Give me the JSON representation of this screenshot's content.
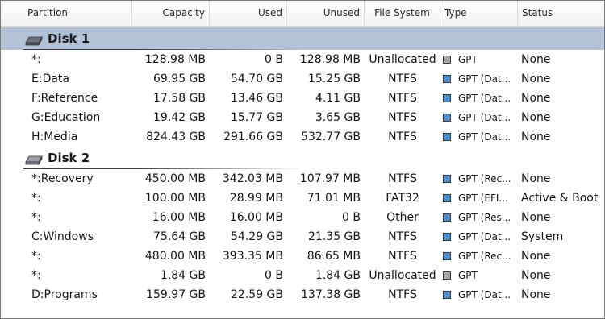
{
  "columns": {
    "partition": "Partition",
    "capacity": "Capacity",
    "used": "Used",
    "unused": "Unused",
    "filesystem": "File System",
    "type": "Type",
    "status": "Status"
  },
  "colors": {
    "selected_row": "#b3c2d6",
    "gpt_data_square": "#4a8ecb",
    "unallocated_square": "#a8a8a8"
  },
  "disks": [
    {
      "label": "Disk 1",
      "icon": "hard-disk-icon",
      "selected": true,
      "partitions": [
        {
          "name": "*:",
          "capacity": "128.98 MB",
          "used": "0 B",
          "unused": "128.98 MB",
          "fs": "Unallocated",
          "type": "GPT",
          "status": "None",
          "kind": "unallocated"
        },
        {
          "name": "E:Data",
          "capacity": "69.95 GB",
          "used": "54.70 GB",
          "unused": "15.25 GB",
          "fs": "NTFS",
          "type": "GPT (Dat...",
          "status": "None",
          "kind": "data"
        },
        {
          "name": "F:Reference",
          "capacity": "17.58 GB",
          "used": "13.46 GB",
          "unused": "4.11 GB",
          "fs": "NTFS",
          "type": "GPT (Dat...",
          "status": "None",
          "kind": "data"
        },
        {
          "name": "G:Education",
          "capacity": "19.42 GB",
          "used": "15.77 GB",
          "unused": "3.65 GB",
          "fs": "NTFS",
          "type": "GPT (Dat...",
          "status": "None",
          "kind": "data"
        },
        {
          "name": "H:Media",
          "capacity": "824.43 GB",
          "used": "291.66 GB",
          "unused": "532.77 GB",
          "fs": "NTFS",
          "type": "GPT (Dat...",
          "status": "None",
          "kind": "data"
        }
      ]
    },
    {
      "label": "Disk 2",
      "icon": "hard-disk-icon",
      "selected": false,
      "partitions": [
        {
          "name": "*:Recovery",
          "capacity": "450.00 MB",
          "used": "342.03 MB",
          "unused": "107.97 MB",
          "fs": "NTFS",
          "type": "GPT (Rec...",
          "status": "None",
          "kind": "data"
        },
        {
          "name": "*:",
          "capacity": "100.00 MB",
          "used": "28.99 MB",
          "unused": "71.01 MB",
          "fs": "FAT32",
          "type": "GPT (EFI...",
          "status": "Active & Boot",
          "kind": "data"
        },
        {
          "name": "*:",
          "capacity": "16.00 MB",
          "used": "16.00 MB",
          "unused": "0 B",
          "fs": "Other",
          "type": "GPT (Res...",
          "status": "None",
          "kind": "data"
        },
        {
          "name": "C:Windows",
          "capacity": "75.64 GB",
          "used": "54.29 GB",
          "unused": "21.35 GB",
          "fs": "NTFS",
          "type": "GPT (Dat...",
          "status": "System",
          "kind": "data"
        },
        {
          "name": "*:",
          "capacity": "480.00 MB",
          "used": "393.35 MB",
          "unused": "86.65 MB",
          "fs": "NTFS",
          "type": "GPT (Rec...",
          "status": "None",
          "kind": "data"
        },
        {
          "name": "*:",
          "capacity": "1.84 GB",
          "used": "0 B",
          "unused": "1.84 GB",
          "fs": "Unallocated",
          "type": "GPT",
          "status": "None",
          "kind": "unallocated"
        },
        {
          "name": "D:Programs",
          "capacity": "159.97 GB",
          "used": "22.59 GB",
          "unused": "137.38 GB",
          "fs": "NTFS",
          "type": "GPT (Dat...",
          "status": "None",
          "kind": "data"
        }
      ]
    }
  ]
}
